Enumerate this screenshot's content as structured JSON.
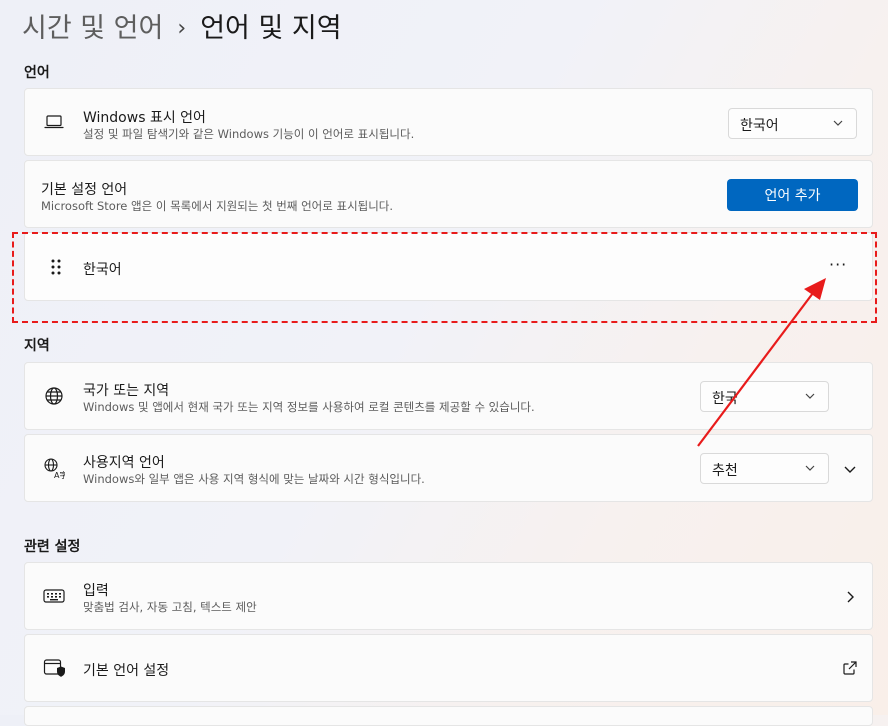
{
  "breadcrumb": {
    "parent": "시간 및 언어",
    "separator": "›",
    "current": "언어 및 지역"
  },
  "language_section": {
    "title": "언어",
    "display_language": {
      "title": "Windows 표시 언어",
      "desc": "설정 및 파일 탐색기와 같은 Windows 기능이 이 언어로 표시됩니다.",
      "value": "한국어",
      "icon": "laptop-icon"
    },
    "preferred": {
      "title": "기본 설정 언어",
      "desc": "Microsoft Store 앱은 이 목록에서 지원되는 첫 번째 언어로 표시됩니다.",
      "button": "언어 추가"
    },
    "language_item": {
      "label": "한국어",
      "more": "···",
      "icon": "drag-handle-icon"
    }
  },
  "region_section": {
    "title": "지역",
    "country": {
      "title": "국가 또는 지역",
      "desc": "Windows 및 앱에서 현재 국가 또는 지역 정보를 사용하여 로컬 콘텐츠를 제공할 수 있습니다.",
      "value": "한국",
      "icon": "globe-icon"
    },
    "regional_format": {
      "title": "사용지역 언어",
      "desc": "Windows와 일부 앱은 사용 지역 형식에 맞는 날짜와 시간 형식입니다.",
      "value": "추천",
      "icon": "language-format-icon"
    }
  },
  "related_section": {
    "title": "관련 설정",
    "typing": {
      "title": "입력",
      "desc": "맞춤법 검사, 자동 고침, 텍스트 제안",
      "icon": "keyboard-icon"
    },
    "admin_language": {
      "title": "기본 언어 설정",
      "icon": "admin-language-icon"
    }
  },
  "annotation": {
    "highlight_color": "#e81b1b",
    "arrow_color": "#e81b1b"
  },
  "colors": {
    "accent": "#0067c0"
  }
}
